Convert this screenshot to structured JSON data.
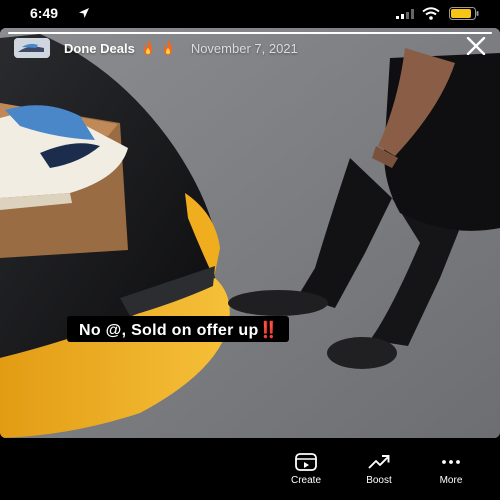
{
  "status_bar": {
    "time": "6:49",
    "icons": [
      "location-arrow-icon",
      "cellular-signal-icon",
      "wifi-icon",
      "battery-icon"
    ],
    "battery_color": "#f5c518"
  },
  "story": {
    "account_name": "Done Deals",
    "account_emoji": [
      "fire-icon",
      "fire-icon"
    ],
    "date": "November 7, 2021",
    "progress": 1.0,
    "caption": "No @, Sold on offer up‼️",
    "close_icon": "close-icon"
  },
  "actions": [
    {
      "label": "Create",
      "icon": "create-icon"
    },
    {
      "label": "Boost",
      "icon": "boost-trend-icon"
    },
    {
      "label": "More",
      "icon": "more-dots-icon"
    }
  ],
  "colors": {
    "car_yellow": "#f0ae1e",
    "sneaker_blue": "#4a87c9",
    "background": "#000000"
  }
}
